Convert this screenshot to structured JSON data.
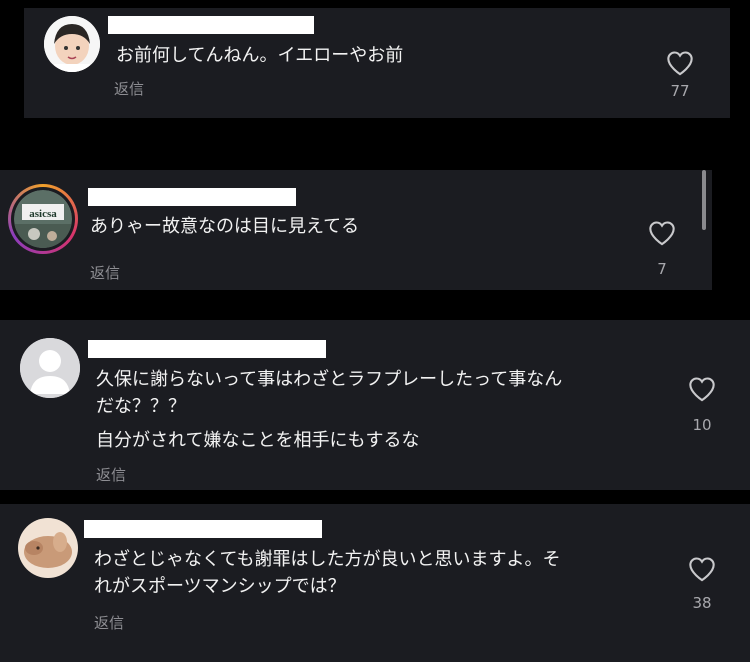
{
  "comments": [
    {
      "text_lines": [
        "お前何してんねん。イエローやお前"
      ],
      "reply_label": "返信",
      "like_count": "77"
    },
    {
      "text_lines": [
        "ありゃー故意なのは目に見えてる"
      ],
      "reply_label": "返信",
      "like_count": "7",
      "avatar_badge": "asicsa"
    },
    {
      "text_lines": [
        "久保に謝らないって事はわざとラフプレーしたって事なん",
        "だな？？？",
        "自分がされて嫌なことを相手にもするな"
      ],
      "reply_label": "返信",
      "like_count": "10"
    },
    {
      "text_lines": [
        "わざとじゃなくても謝罪はした方が良いと思いますよ。そ",
        "れがスポーツマンシップでは？"
      ],
      "reply_label": "返信",
      "like_count": "38"
    }
  ],
  "icons": {
    "like": "heart-outline-icon"
  },
  "colors": {
    "background": "#000000",
    "card": "#1b1c21",
    "text": "#f2f2f2",
    "muted": "#8e8e93"
  }
}
